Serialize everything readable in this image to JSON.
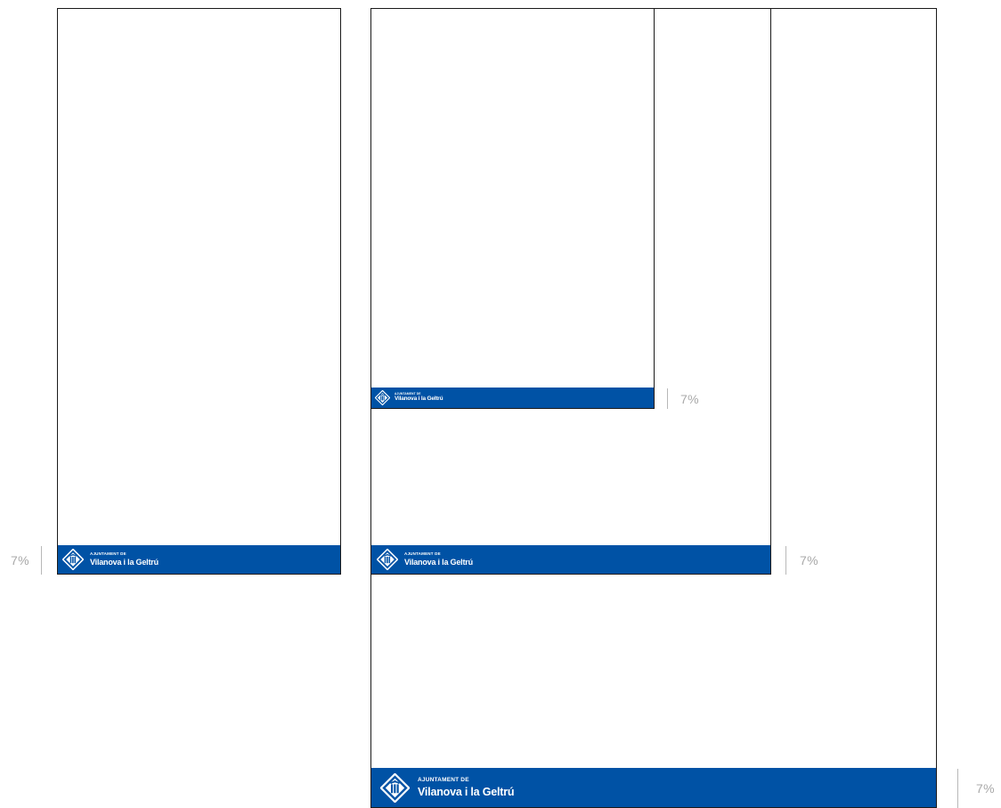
{
  "colors": {
    "band": "#0052a5",
    "sheet_border": "#1a1a1a",
    "measure": "#a9a9a9",
    "logo": "#ffffff"
  },
  "logo": {
    "line1": "AJUNTAMENT DE",
    "line2": "Vilanova i la Geltrú",
    "icon": "municipal-shield-icon"
  },
  "formats": [
    {
      "id": "format-a",
      "band_label": "7%"
    },
    {
      "id": "format-b",
      "band_label": "7%"
    },
    {
      "id": "format-c",
      "band_label": "7%"
    },
    {
      "id": "format-d",
      "band_label": "7%"
    }
  ]
}
